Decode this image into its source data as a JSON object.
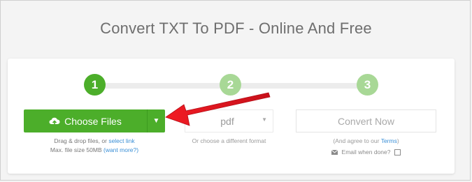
{
  "page": {
    "title": "Convert TXT To PDF - Online And Free"
  },
  "steps": [
    {
      "number": "1",
      "state": "active"
    },
    {
      "number": "2",
      "state": "inactive"
    },
    {
      "number": "3",
      "state": "inactive"
    }
  ],
  "upload": {
    "button_label": "Choose Files",
    "hint_line1_prefix": "Drag & drop files, or ",
    "hint_line1_link": "select link",
    "hint_line2_prefix": "Max. file size 50MB ",
    "hint_line2_link": "(want more?)"
  },
  "format": {
    "selected": "pdf",
    "hint": "Or choose a different format"
  },
  "convert": {
    "button_label": "Convert Now",
    "terms_prefix": "(And agree to our ",
    "terms_link": "Terms",
    "terms_suffix": ")",
    "email_label": "Email when done?"
  },
  "colors": {
    "accent": "#4cae2a",
    "accent_light": "#a8d896",
    "link": "#3a8fd6",
    "annotation_arrow": "#e3151e"
  },
  "icons": {
    "upload": "cloud-upload-icon",
    "dropdown": "caret-down-icon",
    "email": "envelope-icon",
    "annotation": "red-arrow"
  }
}
